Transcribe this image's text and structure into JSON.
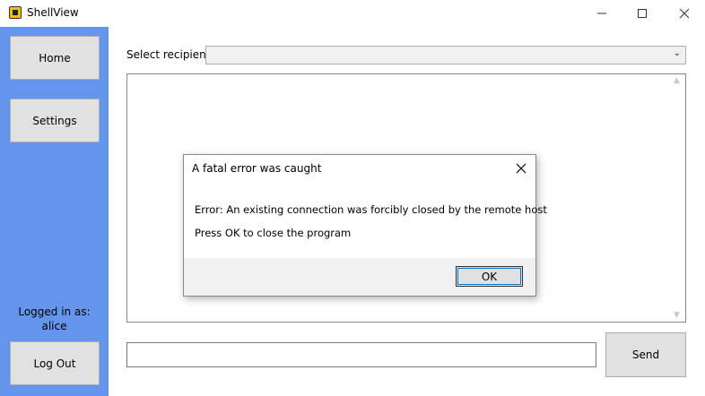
{
  "window": {
    "title": "ShellView",
    "app_icon": "app-icon",
    "minimize_icon": "minimize-icon",
    "maximize_icon": "maximize-icon",
    "close_icon": "close-icon"
  },
  "sidebar": {
    "home_label": "Home",
    "settings_label": "Settings",
    "logged_in_label": "Logged in as:",
    "username": "alice",
    "logout_label": "Log Out",
    "background_color": "#6495ed"
  },
  "main": {
    "recipient_label": "Select recipient:",
    "recipient_value": "",
    "message_value": "",
    "send_label": "Send"
  },
  "dialog": {
    "title": "A fatal error was caught",
    "message_error": "Error: An existing connection was forcibly closed by the remote host",
    "message_instruction": "Press OK to close the program",
    "ok_label": "OK"
  }
}
